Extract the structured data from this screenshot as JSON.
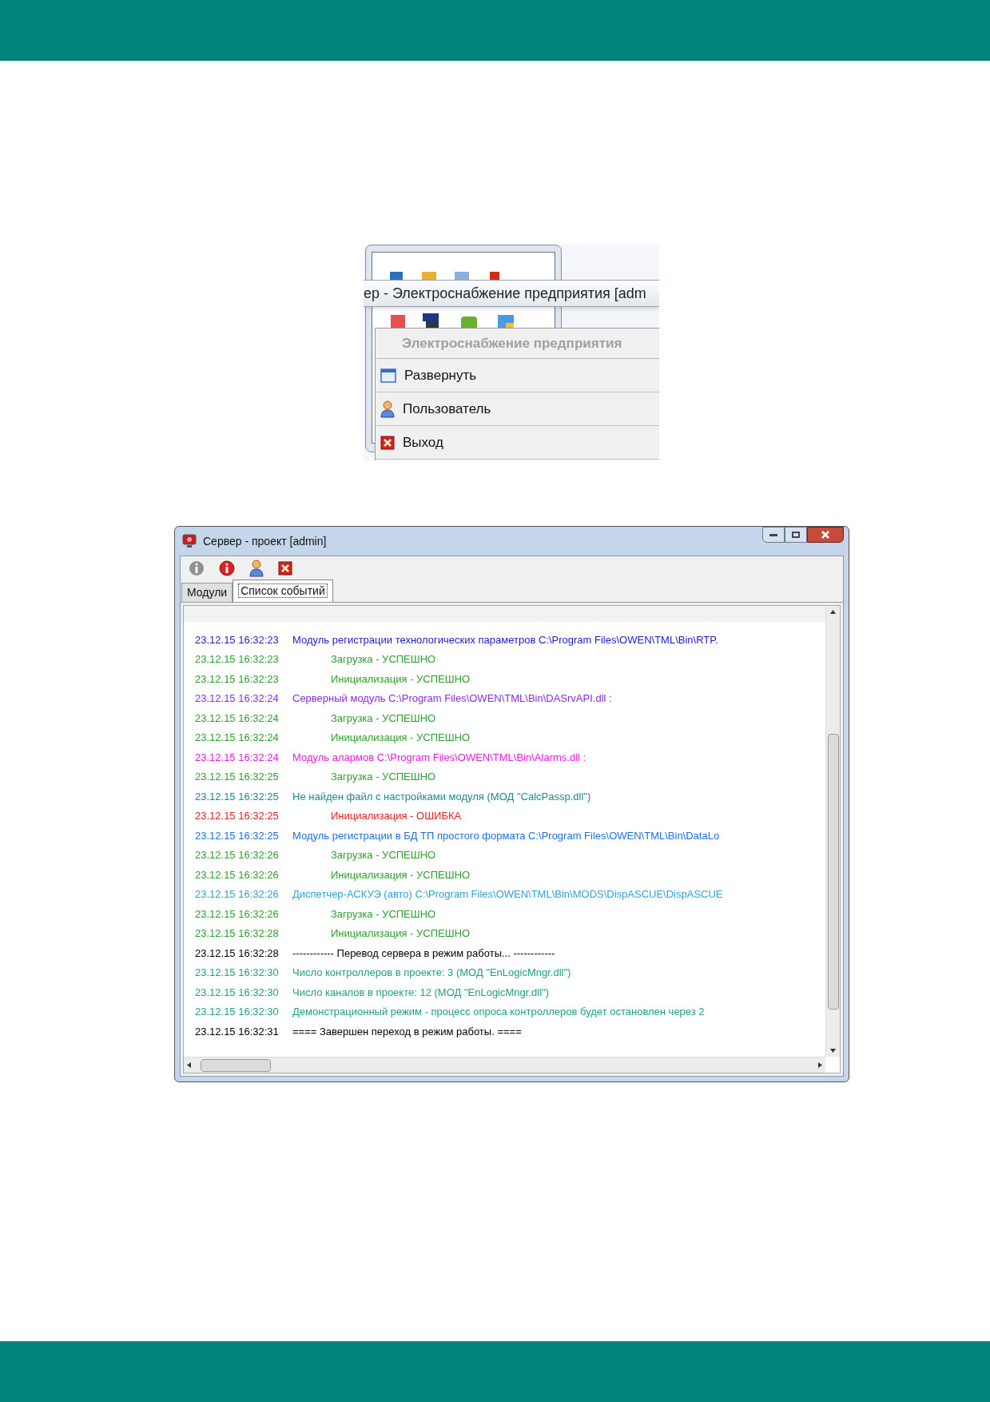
{
  "top_screenshot": {
    "tooltip_title": "ер - Электроснабжение предприятия [adm",
    "menu": {
      "header": "Электроснабжение предприятия",
      "items": [
        {
          "label": "Развернуть",
          "kind": "window"
        },
        {
          "label": "Пользователь",
          "kind": "user"
        },
        {
          "label": "Выход",
          "kind": "exit"
        }
      ]
    }
  },
  "window": {
    "title": "Сервер - проект [admin]",
    "tabs": [
      {
        "label": "Модули",
        "selected": false
      },
      {
        "label": "Список событий",
        "selected": true
      }
    ],
    "events": [
      {
        "time": "23.12.15 16:32:23",
        "message": "Модуль регистрации технологических параметров C:\\Program Files\\OWEN\\TML\\Bin\\RTP.",
        "kind": "module",
        "color": "#1c1cc8"
      },
      {
        "time": "23.12.15 16:32:23",
        "message": "Загрузка - УСПЕШНО",
        "kind": "step",
        "color": "#2ca02c"
      },
      {
        "time": "23.12.15 16:32:23",
        "message": "Инициализация - УСПЕШНО",
        "kind": "step",
        "color": "#2ca02c"
      },
      {
        "time": "23.12.15 16:32:24",
        "message": "Серверный модуль C:\\Program Files\\OWEN\\TML\\Bin\\DASrvAPI.dll :",
        "kind": "module",
        "color": "#8a2be2"
      },
      {
        "time": "23.12.15 16:32:24",
        "message": "Загрузка - УСПЕШНО",
        "kind": "step",
        "color": "#2ca02c"
      },
      {
        "time": "23.12.15 16:32:24",
        "message": "Инициализация - УСПЕШНО",
        "kind": "step",
        "color": "#2ca02c"
      },
      {
        "time": "23.12.15 16:32:24",
        "message": "Модуль алармов C:\\Program Files\\OWEN\\TML\\Bin\\Alarms.dll :",
        "kind": "module",
        "color": "#e020d8"
      },
      {
        "time": "23.12.15 16:32:25",
        "message": "Загрузка - УСПЕШНО",
        "kind": "step",
        "color": "#2ca02c"
      },
      {
        "time": "23.12.15 16:32:25",
        "message": "Не найден файл с настройками модуля (МОД \"CalcPassp.dll\")",
        "kind": "module",
        "color": "#208888"
      },
      {
        "time": "23.12.15 16:32:25",
        "message": "Инициализация - ОШИБКА",
        "kind": "step",
        "color": "#e02020"
      },
      {
        "time": "23.12.15 16:32:25",
        "message": "Модуль регистрации в БД ТП простого формата C:\\Program Files\\OWEN\\TML\\Bin\\DataLo",
        "kind": "module",
        "color": "#2070e0"
      },
      {
        "time": "23.12.15 16:32:26",
        "message": "Загрузка - УСПЕШНО",
        "kind": "step",
        "color": "#2ca02c"
      },
      {
        "time": "23.12.15 16:32:26",
        "message": "Инициализация - УСПЕШНО",
        "kind": "step",
        "color": "#2ca02c"
      },
      {
        "time": "23.12.15 16:32:26",
        "message": "Диспетчер-АСКУЭ (авто) C:\\Program Files\\OWEN\\TML\\Bin\\MODS\\DispASCUE\\DispASCUE",
        "kind": "module",
        "color": "#30a0d8"
      },
      {
        "time": "23.12.15 16:32:26",
        "message": "Загрузка - УСПЕШНО",
        "kind": "step",
        "color": "#2ca02c"
      },
      {
        "time": "23.12.15 16:32:28",
        "message": "Инициализация - УСПЕШНО",
        "kind": "step",
        "color": "#2ca02c"
      },
      {
        "time": "23.12.15 16:32:28",
        "message": "------------ Перевод сервера в режим работы... ------------",
        "kind": "module",
        "color": "#000000"
      },
      {
        "time": "23.12.15 16:32:30",
        "message": "Число контроллеров в проекте: 3 (МОД \"EnLogicMngr.dll\")",
        "kind": "module",
        "color": "#20a080"
      },
      {
        "time": "23.12.15 16:32:30",
        "message": "Число каналов в проекте: 12 (МОД \"EnLogicMngr.dll\")",
        "kind": "module",
        "color": "#20a080"
      },
      {
        "time": "23.12.15 16:32:30",
        "message": "Демонстрационный режим - процесс опроса контроллеров будет остановлен через 2",
        "kind": "module",
        "color": "#20a080"
      },
      {
        "time": "23.12.15 16:32:31",
        "message": "==== Завершен переход в режим работы. ====",
        "kind": "module",
        "color": "#000000"
      }
    ]
  }
}
